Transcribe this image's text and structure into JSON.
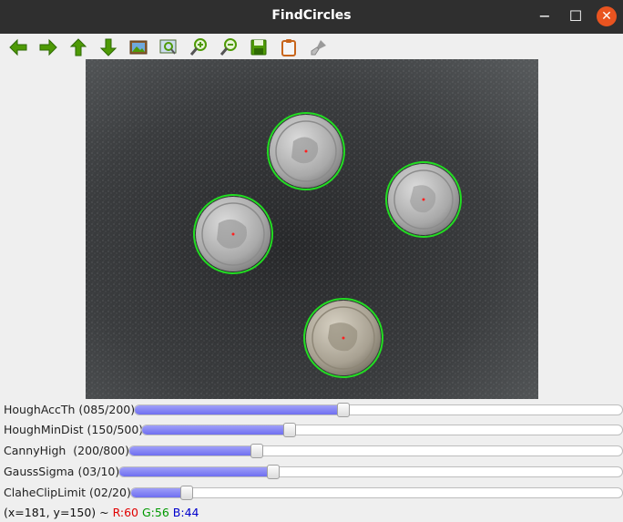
{
  "window": {
    "title": "FindCircles",
    "minimize": "−",
    "maximize": "☐",
    "close": "✕"
  },
  "toolbar": {
    "icons": [
      "arrow-left-icon",
      "arrow-right-icon",
      "arrow-up-icon",
      "arrow-down-icon",
      "image-icon",
      "zoom-fit-icon",
      "zoom-in-icon",
      "zoom-out-icon",
      "save-icon",
      "clipboard-icon",
      "brush-icon"
    ]
  },
  "image": {
    "description_colors": {
      "circle": "#22dd22",
      "center": "#ff2020"
    }
  },
  "sliders": [
    {
      "label": "HoughAccTh (085/200)",
      "value": 85,
      "max": 200
    },
    {
      "label": "HoughMinDist (150/500)",
      "value": 150,
      "max": 500
    },
    {
      "label": "CannyHigh  (200/800)",
      "value": 200,
      "max": 800
    },
    {
      "label": "GaussSigma (03/10)",
      "value": 3,
      "max": 10
    },
    {
      "label": "ClaheClipLimit (02/20)",
      "value": 2,
      "max": 20
    }
  ],
  "status": {
    "coords": "(x=181, y=150) ~ ",
    "r": "R:60",
    "g": "G:56",
    "b": "B:44",
    "colors": {
      "r": "#e00000",
      "g": "#009900",
      "b": "#0000cc"
    }
  }
}
